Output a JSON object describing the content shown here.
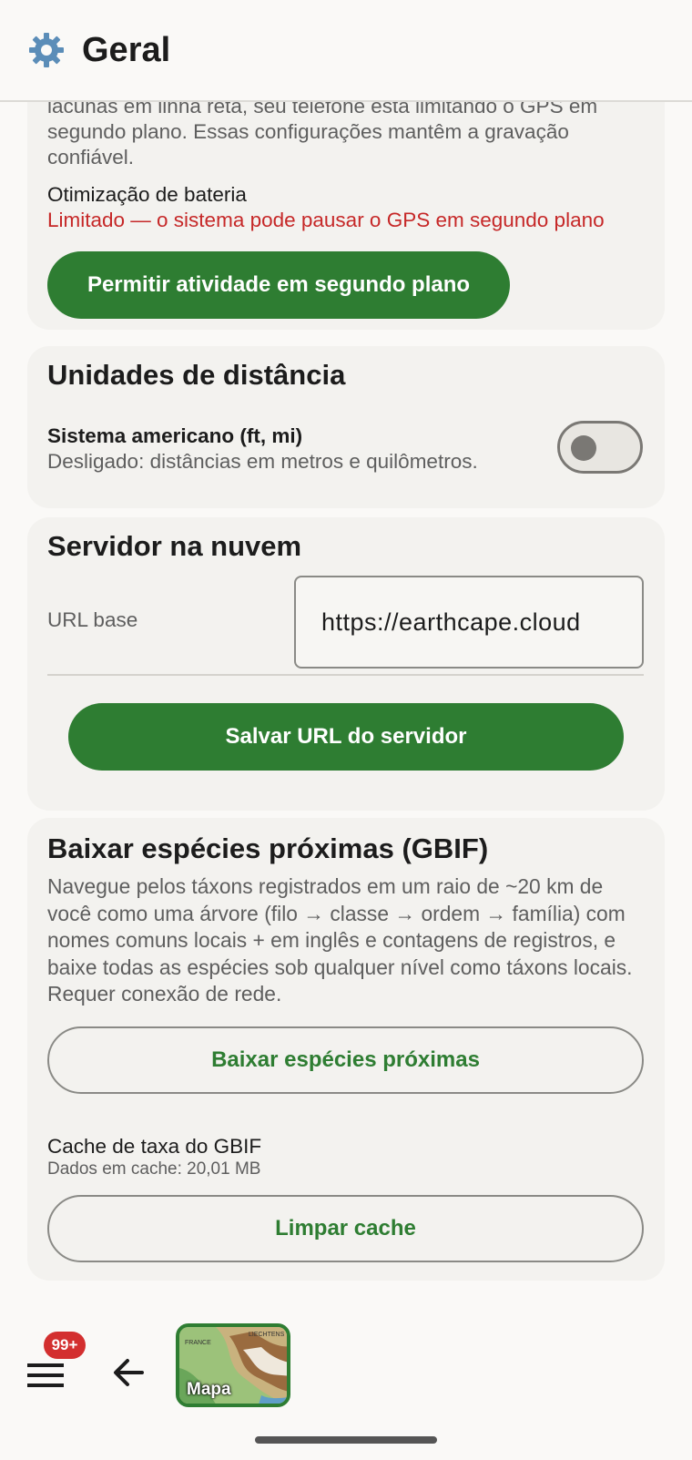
{
  "appbar": {
    "title": "Geral",
    "icon": "gear-icon"
  },
  "battery_card": {
    "intro_text": "lacunas em linha reta, seu telefone está limitando o GPS em segundo plano. Essas configurações mantêm a gravação confiável.",
    "optimization_label": "Otimização de bateria",
    "optimization_status": "Limitado — o sistema pode pausar o GPS em segundo plano",
    "allow_button": "Permitir atividade em segundo plano"
  },
  "units_card": {
    "title": "Unidades de distância",
    "toggle_label": "Sistema americano (ft, mi)",
    "toggle_description": "Desligado: distâncias em metros e quilômetros.",
    "toggle_on": false
  },
  "server_card": {
    "title": "Servidor na nuvem",
    "url_label": "URL base",
    "url_value": "https://earthcape.cloud",
    "save_button": "Salvar URL do servidor"
  },
  "gbif_card": {
    "title": "Baixar espécies próximas (GBIF)",
    "description": "Navegue pelos táxons registrados em um raio de ~20 km de você como uma árvore (filo → classe → ordem → família) com nomes comuns locais + em inglês e contagens de registros, e baixe todas as espécies sob qualquer nível como táxons locais. Requer conexão de rede.",
    "download_button": "Baixar espécies próximas",
    "cache_title": "Cache de taxa do GBIF",
    "cache_size": "Dados em cache: 20,01 MB",
    "clear_button": "Limpar cache"
  },
  "bottombar": {
    "badge": "99+",
    "map_label": "Mapa",
    "map_tiny_labels": [
      "FRANCE",
      "LIECHTENS"
    ]
  },
  "colors": {
    "primary": "#2e7d32",
    "error": "#c62828",
    "badge": "#d32f2f",
    "background": "#faf9f7",
    "card": "#f3f2ef"
  }
}
